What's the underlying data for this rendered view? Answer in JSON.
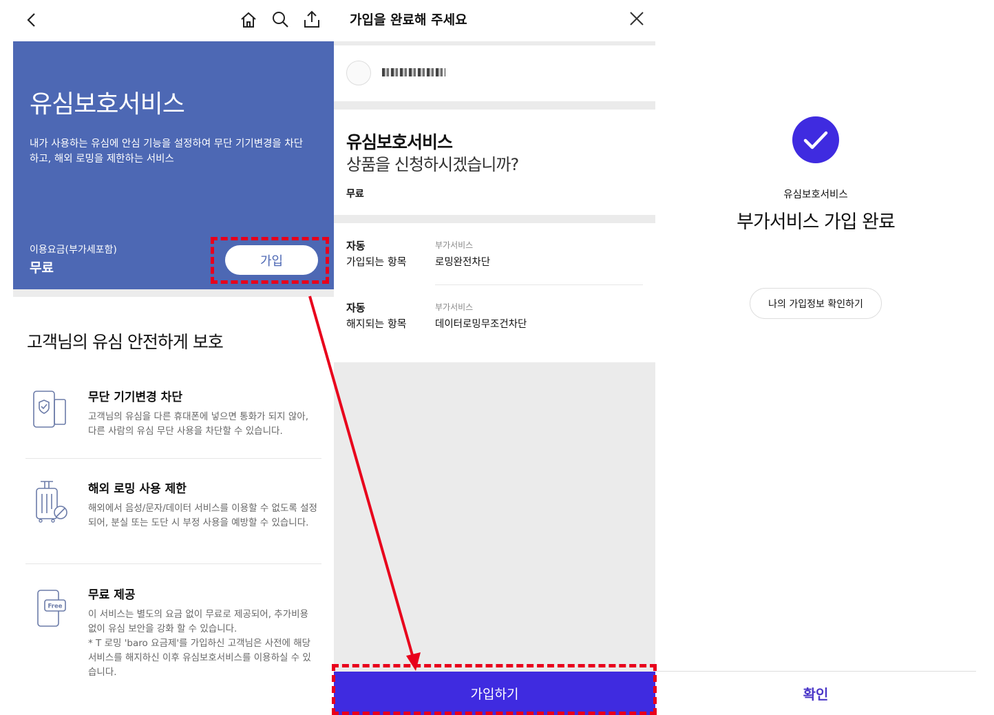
{
  "left_panel": {
    "nav_icons": [
      "back-icon",
      "home-icon",
      "search-icon",
      "share-icon"
    ],
    "hero": {
      "title": "유심보호서비스",
      "description": "내가 사용하는 유심에 안심 기능을 설정하여 무단 기기변경을 차단하고, 해외 로밍을 제한하는 서비스",
      "fee_label": "이용요금(부가세포함)",
      "fee_value": "무료",
      "join_label": "가입",
      "background": "#4d68b4"
    },
    "section_title": "고객님의 유심 안전하게 보호",
    "features": [
      {
        "icon": "phone-shield-icon",
        "title": "무단 기기변경 차단",
        "description": "고객님의 유심을 다른 휴대폰에 넣으면 통화가 되지 않아, 다른 사람의 유심 무단 사용을 차단할 수 있습니다."
      },
      {
        "icon": "luggage-ban-icon",
        "title": "해외 로밍 사용 제한",
        "description": "해외에서 음성/문자/데이터 서비스를 이용할 수 없도록 설정되어, 분실 또는 도단 시 부정 사용을 예방할 수 있습니다."
      },
      {
        "icon": "phone-free-icon",
        "title": "무료 제공",
        "description": "이 서비스는 별도의 요금 없이 무료로 제공되어, 추가비용 없이 유심 보안을 강화 할 수 있습니다.",
        "note": "* T 로밍 'baro 요금제'를 가입하신 고객님은 사전에 해당 서비스를 해지하신 이후 유심보호서비스를 이용하실 수 있습니다.",
        "icon_text": "Free"
      }
    ]
  },
  "middle_panel": {
    "title": "가입을 완료해 주세요",
    "close_icon": "close-icon",
    "service_name": "유심보호서비스",
    "question": "상품을 신청하시겠습니까?",
    "price": "무료",
    "rows": [
      {
        "key1": "자동",
        "key2": "가입되는 항목",
        "category": "부가서비스",
        "value": "로밍완전차단"
      },
      {
        "key1": "자동",
        "key2": "해지되는 항목",
        "category": "부가서비스",
        "value": "데이터로밍무조건차단"
      }
    ],
    "submit_label": "가입하기",
    "accent": "#3f2be0"
  },
  "right_panel": {
    "check_icon": "check-icon",
    "subtitle": "유심보호서비스",
    "headline": "부가서비스 가입 완료",
    "my_info_label": "나의 가입정보 확인하기",
    "confirm_label": "확인"
  },
  "annotation_color": "#e8001c"
}
